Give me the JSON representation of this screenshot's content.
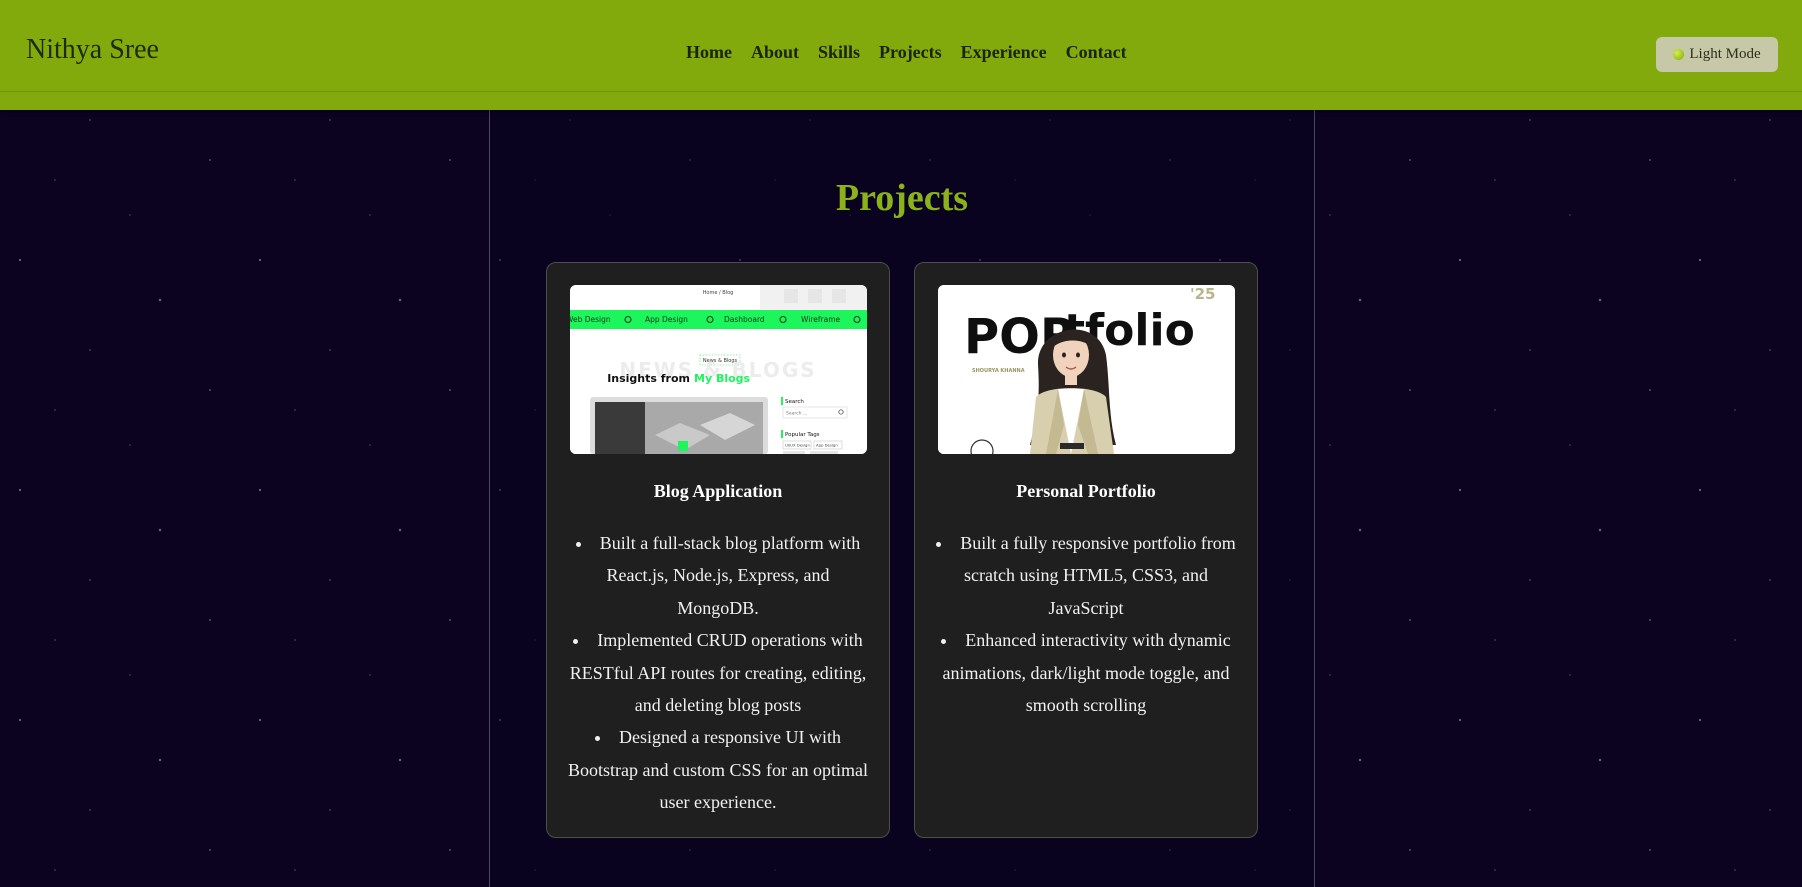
{
  "header": {
    "brand": "Nithya Sree",
    "nav": [
      "Home",
      "About",
      "Skills",
      "Projects",
      "Experience",
      "Contact"
    ],
    "mode_toggle_label": "Light Mode"
  },
  "projects": {
    "title": "Projects",
    "cards": [
      {
        "title": "Blog Application",
        "thumbnail": {
          "breadcrumb": "Home / Blog",
          "tags": [
            "Web Design",
            "App Design",
            "Dashboard",
            "Wireframe"
          ],
          "chip": "News & Blogs",
          "watermark": "NEWS & BLOGS",
          "headline_prefix": "Insights from",
          "headline_accent": "My Blogs",
          "search_heading": "Search",
          "search_placeholder": "Search ...",
          "popular_tags_heading": "Popular Tags",
          "popular_tags": [
            "UI/UX Design",
            "App Design"
          ]
        },
        "bullets": [
          "Built a full-stack blog platform with React.js, Node.js, Express, and MongoDB.",
          "Implemented CRUD operations with RESTful API routes for creating, editing, and deleting blog posts",
          "Designed a responsive UI with Bootstrap and custom CSS for an optimal user experience."
        ]
      },
      {
        "title": "Personal Portfolio",
        "thumbnail": {
          "word_part1": "POR",
          "word_part2": "tfolio",
          "year": "'25",
          "name": "SHOURYA KHANNA"
        },
        "bullets": [
          "Built a fully responsive portfolio from scratch using HTML5, CSS3, and JavaScript",
          "Enhanced interactivity with dynamic animations, dark/light mode toggle, and smooth scrolling"
        ]
      }
    ]
  },
  "colors": {
    "header_bg": "#82aa0d",
    "accent": "#8bb218",
    "page_bg": "#0b0320",
    "card_bg": "#1f1f1f",
    "blog_green": "#1df55d"
  }
}
